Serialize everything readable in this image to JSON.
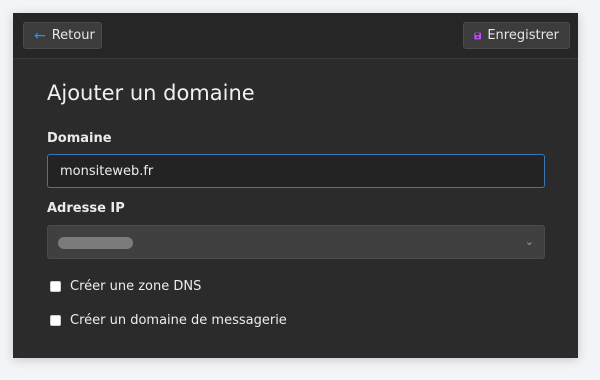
{
  "toolbar": {
    "back_label": "Retour",
    "save_label": "Enregistrer"
  },
  "form": {
    "title": "Ajouter un domaine",
    "domain_label": "Domaine",
    "domain_value": "monsiteweb.fr",
    "ip_label": "Adresse IP",
    "create_dns_label": "Créer une zone DNS",
    "create_mail_label": "Créer un domaine de messagerie"
  },
  "colors": {
    "accent_blue": "#2f8cff",
    "save_icon": "#c24cf0",
    "input_border": "#3a78b5"
  },
  "icons": {
    "back": "arrow-left-icon",
    "save": "floppy-disk-icon",
    "select": "chevron-down-icon"
  }
}
